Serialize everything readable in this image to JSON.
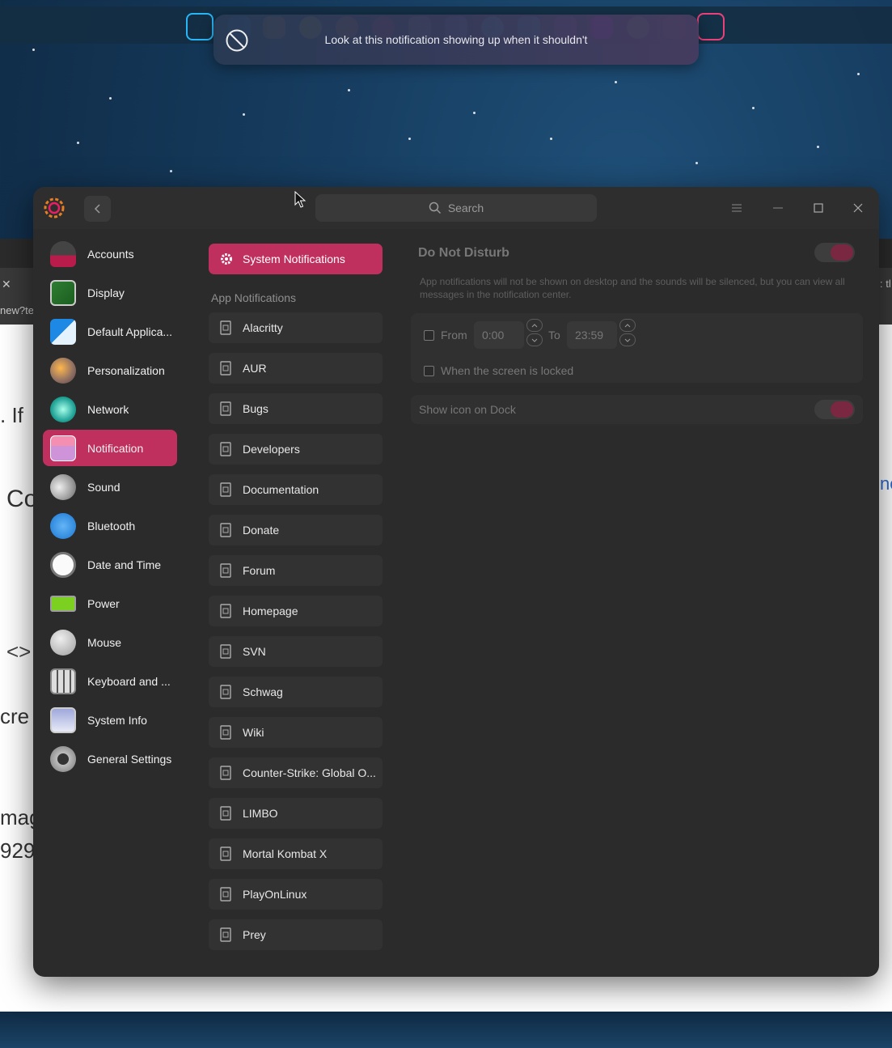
{
  "notification": {
    "message": "Look at this notification showing up when it shouldn't",
    "icon": "ban-icon"
  },
  "window": {
    "search_placeholder": "Search",
    "app_icon": "settings-gear-icon"
  },
  "nav": {
    "items": [
      {
        "label": "Accounts",
        "icon": "accounts-icon"
      },
      {
        "label": "Display",
        "icon": "display-icon"
      },
      {
        "label": "Default Applica...",
        "icon": "default-apps-icon"
      },
      {
        "label": "Personalization",
        "icon": "personalization-icon"
      },
      {
        "label": "Network",
        "icon": "network-icon"
      },
      {
        "label": "Notification",
        "icon": "notification-icon",
        "active": true
      },
      {
        "label": "Sound",
        "icon": "sound-icon"
      },
      {
        "label": "Bluetooth",
        "icon": "bluetooth-icon"
      },
      {
        "label": "Date and Time",
        "icon": "clock-icon"
      },
      {
        "label": "Power",
        "icon": "battery-icon"
      },
      {
        "label": "Mouse",
        "icon": "mouse-icon"
      },
      {
        "label": "Keyboard and ...",
        "icon": "keyboard-icon"
      },
      {
        "label": "System Info",
        "icon": "system-info-icon"
      },
      {
        "label": "General Settings",
        "icon": "general-settings-icon"
      }
    ]
  },
  "middle": {
    "system_notifications": "System Notifications",
    "app_notifications_heading": "App Notifications",
    "apps": [
      "Alacritty",
      "AUR",
      "Bugs",
      "Developers",
      "Documentation",
      "Donate",
      "Forum",
      "Homepage",
      "SVN",
      "Schwag",
      "Wiki",
      "Counter-Strike: Global O...",
      "LIMBO",
      "Mortal Kombat X",
      "PlayOnLinux",
      "Prey"
    ]
  },
  "right": {
    "dnd_title": "Do Not Disturb",
    "dnd_description": "App notifications will not be shown on desktop and the sounds will be silenced, but you can view all messages in the notification center.",
    "from_label": "From",
    "from_value": "0:00",
    "to_label": "To",
    "to_value": "23:59",
    "screen_locked_label": "When the screen is locked",
    "show_icon_label": "Show icon on Dock"
  },
  "background": {
    "fragments": [
      ". If",
      "Co",
      "cre",
      "mag",
      "929",
      "new?te",
      "ne",
      ": tl"
    ]
  },
  "colors": {
    "accent": "#c0305f",
    "window_bg": "#2b2b2b",
    "item_bg": "#323232"
  }
}
